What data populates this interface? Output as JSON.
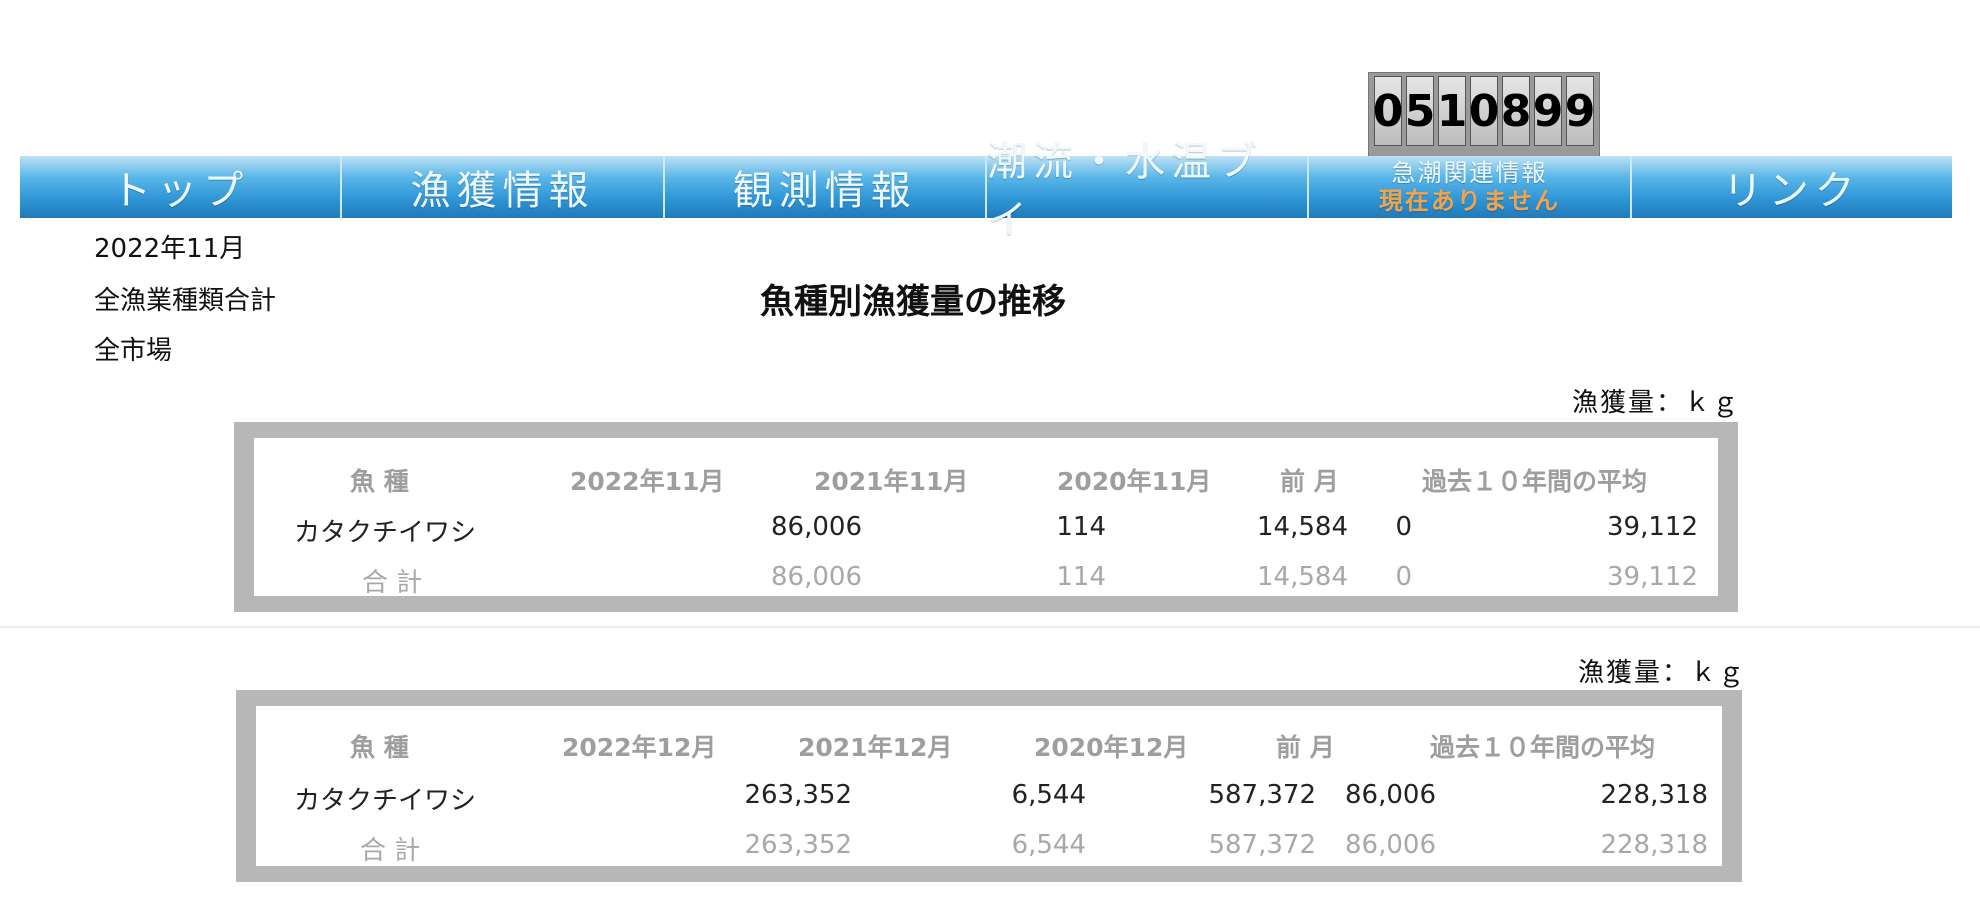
{
  "counter": {
    "digits": [
      "0",
      "5",
      "1",
      "0",
      "8",
      "9",
      "9"
    ]
  },
  "nav": {
    "items": [
      {
        "label": "トップ"
      },
      {
        "label": "漁獲情報"
      },
      {
        "label": "観測情報"
      },
      {
        "label": "潮流・水温ブイ"
      },
      {
        "label": "急潮関連情報",
        "notice": "現在ありません"
      },
      {
        "label": "リンク"
      }
    ]
  },
  "info": {
    "month": "2022年11月",
    "category": "全漁業種類合計",
    "market": "全市場"
  },
  "page_title": "魚種別漁獲量の推移",
  "tables": [
    {
      "unit_label": "漁獲量：ｋｇ",
      "headers": [
        "魚 種",
        "2022年11月",
        "2021年11月",
        "2020年11月",
        "前 月",
        "過去１０年間の平均"
      ],
      "rows": [
        [
          "カタクチイワシ",
          "86,006",
          "114",
          "14,584",
          "0",
          "39,112"
        ]
      ],
      "total": [
        "合 計",
        "86,006",
        "114",
        "14,584",
        "0",
        "39,112"
      ]
    },
    {
      "unit_label": "漁獲量：ｋｇ",
      "headers": [
        "魚 種",
        "2022年12月",
        "2021年12月",
        "2020年12月",
        "前 月",
        "過去１０年間の平均"
      ],
      "rows": [
        [
          "カタクチイワシ",
          "263,352",
          "6,544",
          "587,372",
          "86,006",
          "228,318"
        ]
      ],
      "total": [
        "合 計",
        "263,352",
        "6,544",
        "587,372",
        "86,006",
        "228,318"
      ]
    }
  ]
}
